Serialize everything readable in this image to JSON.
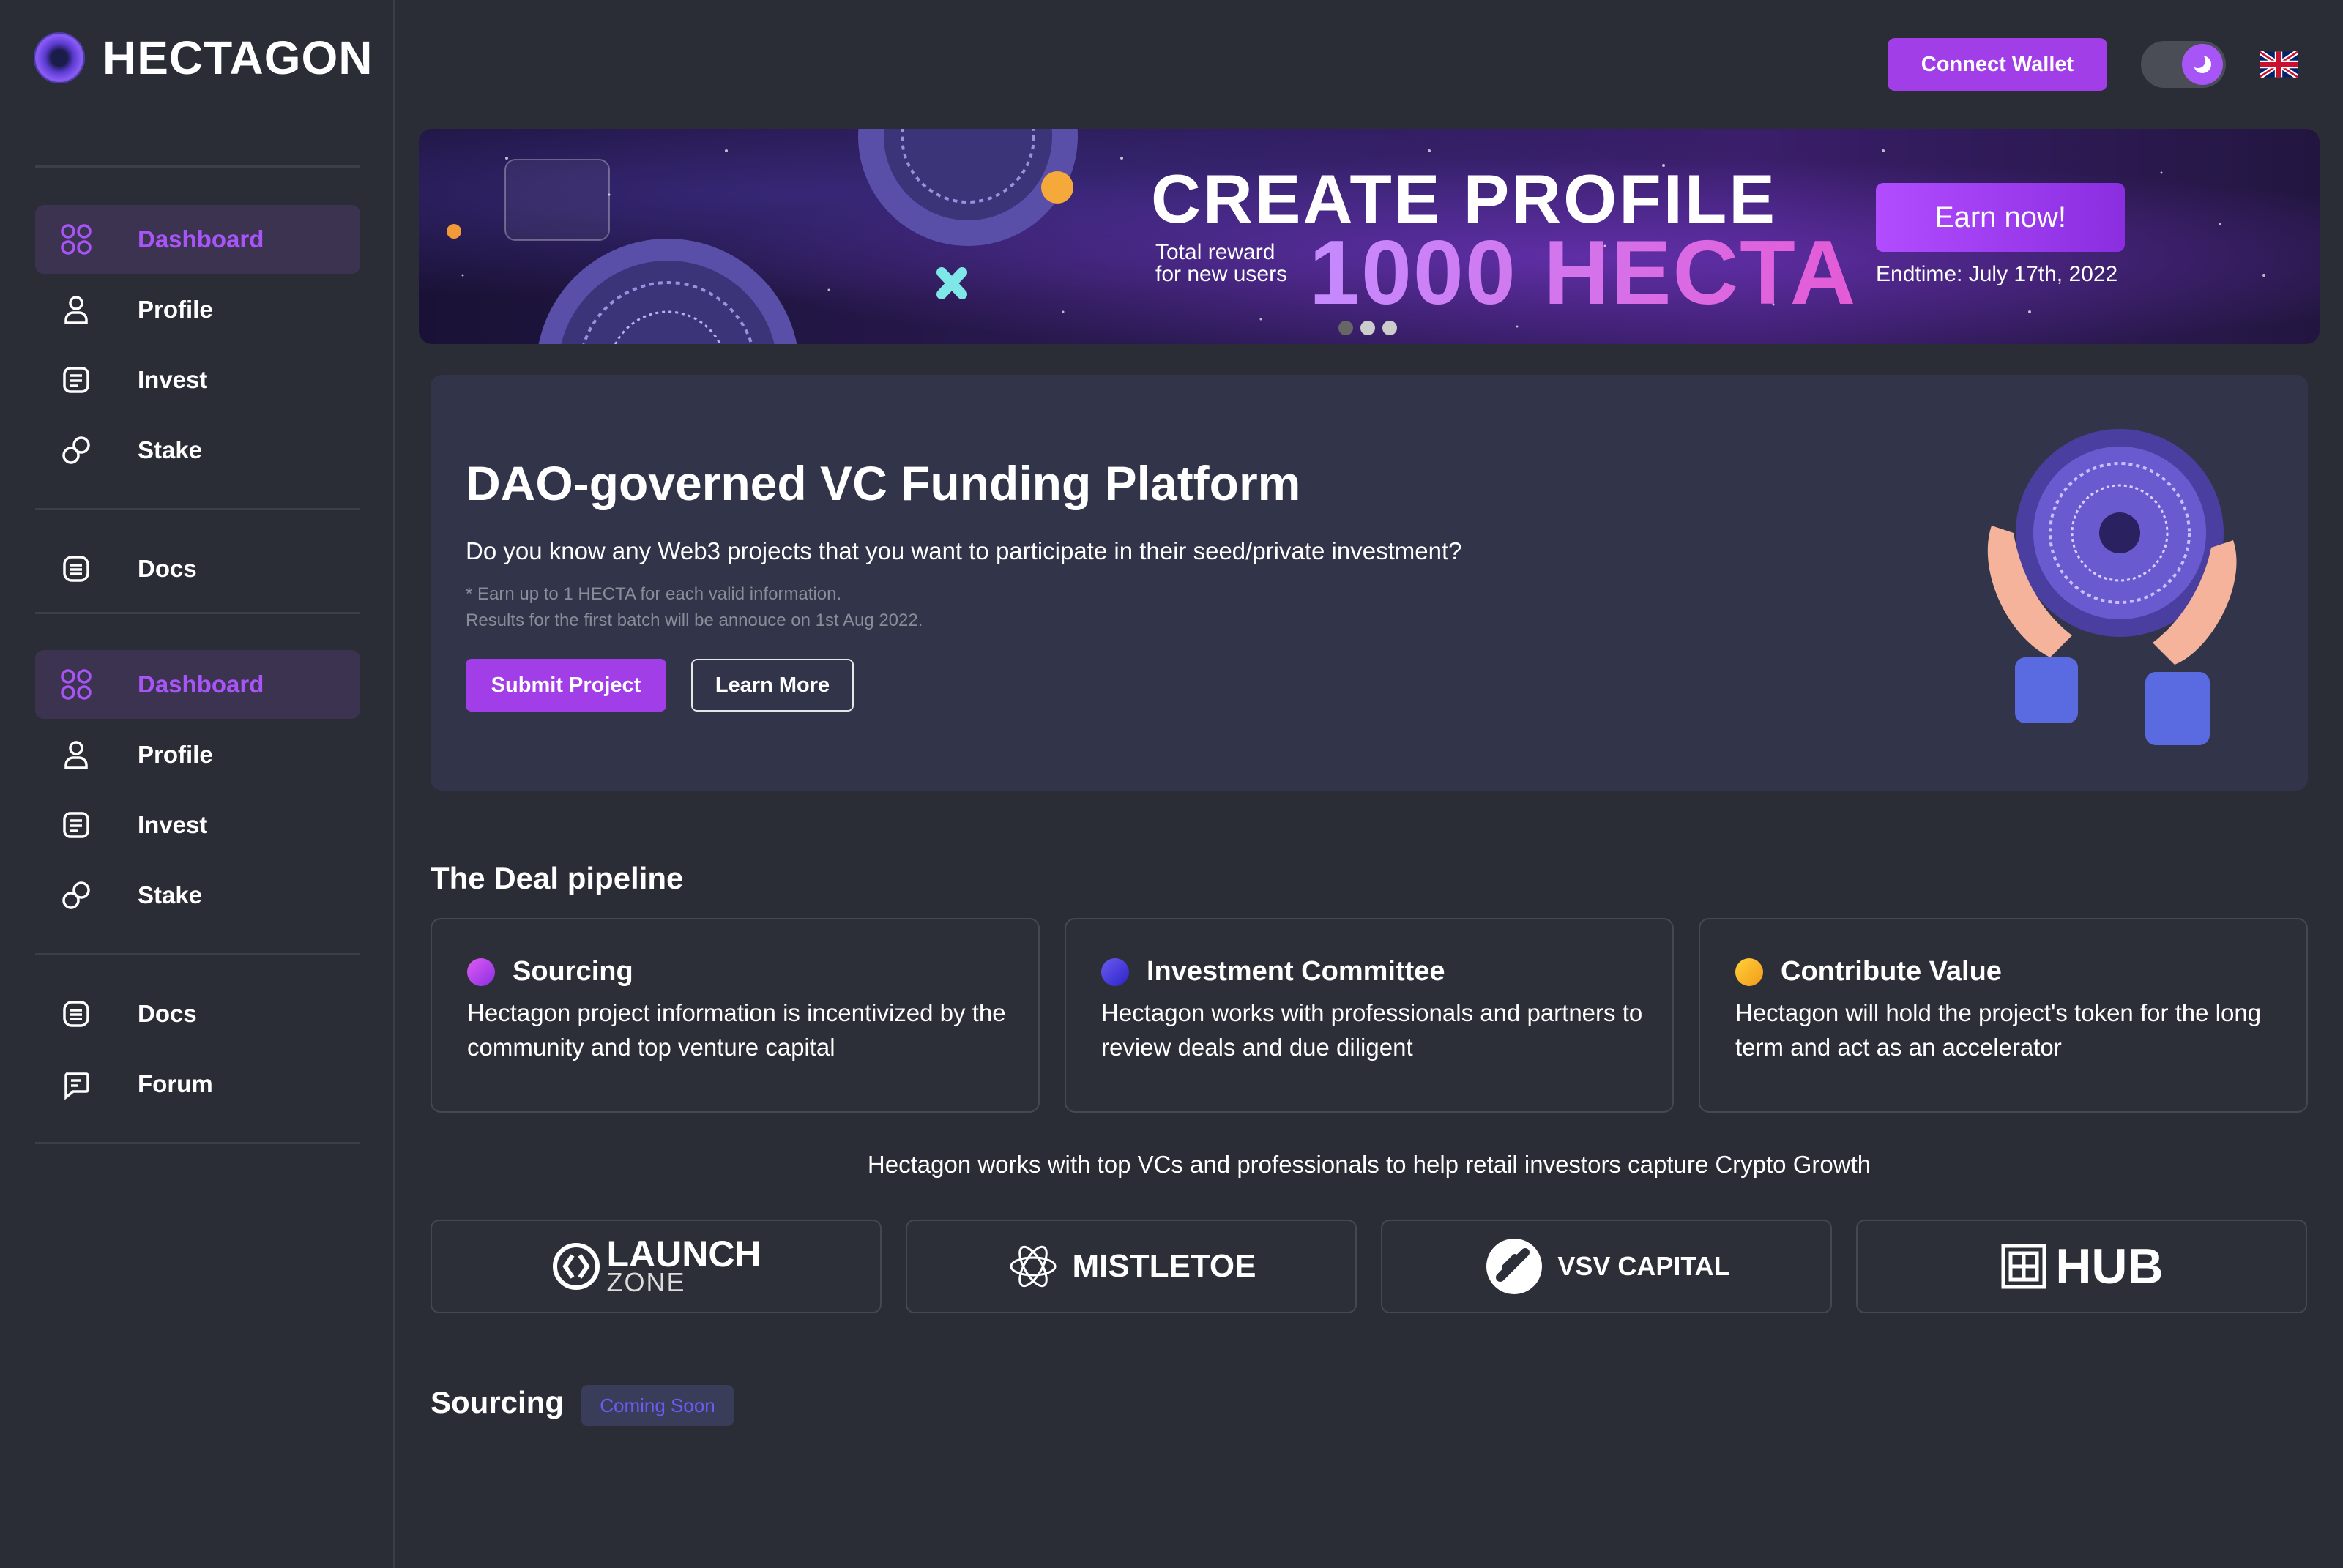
{
  "app": {
    "logo_text": "HECTAGON"
  },
  "sidebar": {
    "group1": [
      {
        "label": "Dashboard",
        "icon": "dashboard-grid-icon",
        "active": true
      },
      {
        "label": "Profile",
        "icon": "user-icon"
      },
      {
        "label": "Invest",
        "icon": "invest-document-icon"
      },
      {
        "label": "Stake",
        "icon": "stake-link-icon"
      },
      {
        "label": "Docs",
        "icon": "docs-icon"
      }
    ],
    "group2": [
      {
        "label": "Dashboard",
        "icon": "dashboard-grid-icon",
        "active": true
      },
      {
        "label": "Profile",
        "icon": "user-icon"
      },
      {
        "label": "Invest",
        "icon": "invest-document-icon"
      },
      {
        "label": "Stake",
        "icon": "stake-link-icon"
      },
      {
        "label": "Docs",
        "icon": "docs-icon"
      },
      {
        "label": "Forum",
        "icon": "forum-chat-icon"
      }
    ]
  },
  "header": {
    "connect_wallet": "Connect Wallet",
    "theme_toggle_icon": "moon-icon",
    "language_icon": "uk-flag-icon"
  },
  "banner": {
    "title": "CREATE PROFILE",
    "sub_line1": "Total reward",
    "sub_line2": "for new users",
    "amount": "1000 HECTA",
    "cta": "Earn now!",
    "endtime": "Endtime: July 17th, 2022",
    "slides": 3,
    "active_slide": 2
  },
  "hero": {
    "title": "DAO-governed VC Funding Platform",
    "question": "Do you know any Web3 projects that you want to participate in their seed/private investment?",
    "note1": "* Earn up to 1 HECTA for each valid information.",
    "note2": "Results for the first batch will be annouce on 1st Aug 2022.",
    "submit": "Submit Project",
    "learn": "Learn More"
  },
  "pipeline": {
    "title": "The Deal pipeline",
    "cards": [
      {
        "name": "Sourcing",
        "desc": "Hectagon project information is incentivized by the community and top venture capital",
        "color": "#c04cf5"
      },
      {
        "name": "Investment Committee",
        "desc": "Hectagon works with professionals and partners to review deals and due diligent",
        "color": "#4b3cf0"
      },
      {
        "name": "Contribute Value",
        "desc": "Hectagon will hold the project's token for the long term and act as an accelerator",
        "color": "#f5b80f"
      }
    ]
  },
  "partners": {
    "caption": "Hectagon works with top VCs and professionals to help retail investors capture Crypto Growth",
    "launchzone_top": "LAUNCH",
    "launchzone_bottom": "ZONE",
    "mistletoe": "MISTLETOE",
    "vsv": "VSV CAPITAL",
    "hub": "HUB"
  },
  "sourcing": {
    "title": "Sourcing",
    "badge": "Coming Soon"
  },
  "colors": {
    "accent": "#a23ee8",
    "background": "#2a2d36",
    "card": "#32344a"
  }
}
